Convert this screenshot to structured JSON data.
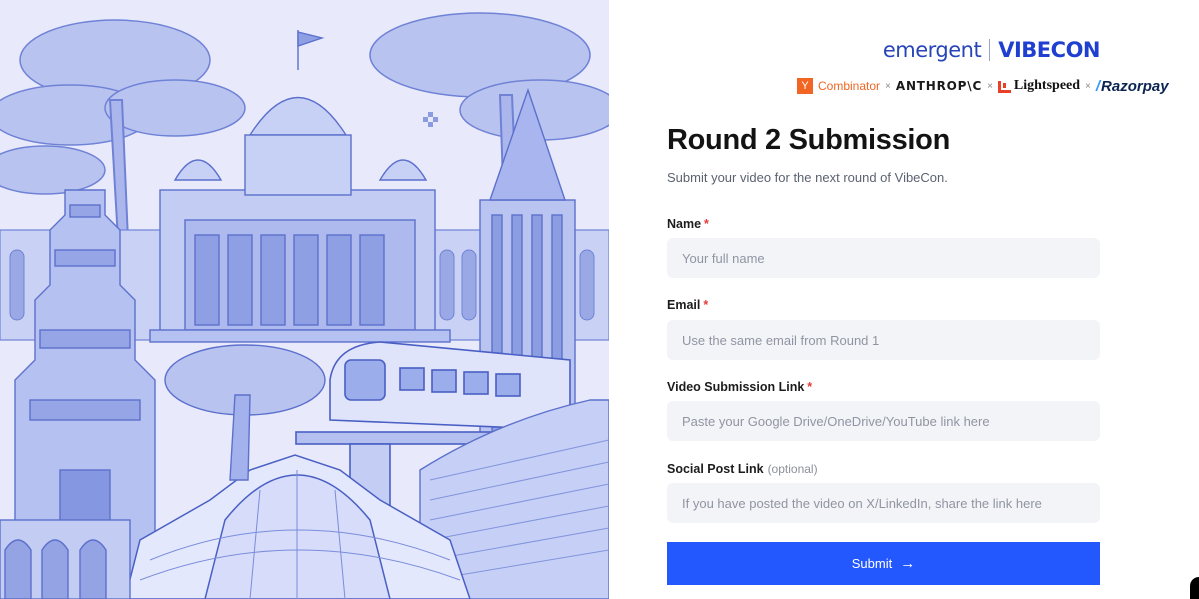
{
  "brand": {
    "primary": "emergent",
    "event": "VIBECON"
  },
  "sponsors": {
    "yc_mark": "Y",
    "yc_name": "Combinator",
    "anthropic": "ANTHROP\\C",
    "lightspeed": "Lightspeed",
    "razorpay": "Razorpay",
    "separator": "×"
  },
  "form": {
    "title": "Round 2 Submission",
    "subtitle": "Submit your video for the next round of VibeCon.",
    "fields": [
      {
        "label": "Name",
        "required_mark": "*",
        "placeholder": "Your full name"
      },
      {
        "label": "Email",
        "required_mark": "*",
        "placeholder": "Use the same email from Round 1"
      },
      {
        "label": "Video Submission Link",
        "required_mark": "*",
        "placeholder": "Paste your Google Drive/OneDrive/YouTube link here"
      },
      {
        "label": "Social Post Link",
        "optional_note": "(optional)",
        "placeholder": "If you have posted the video on X/LinkedIn, share the link here"
      }
    ],
    "submit_label": "Submit",
    "submit_icon": "arrow-right-icon"
  },
  "colors": {
    "accent": "#2458ff",
    "brand_blue": "#1f3fd1",
    "illustration_tint": "#6f82d6",
    "required": "#e23b3b"
  }
}
